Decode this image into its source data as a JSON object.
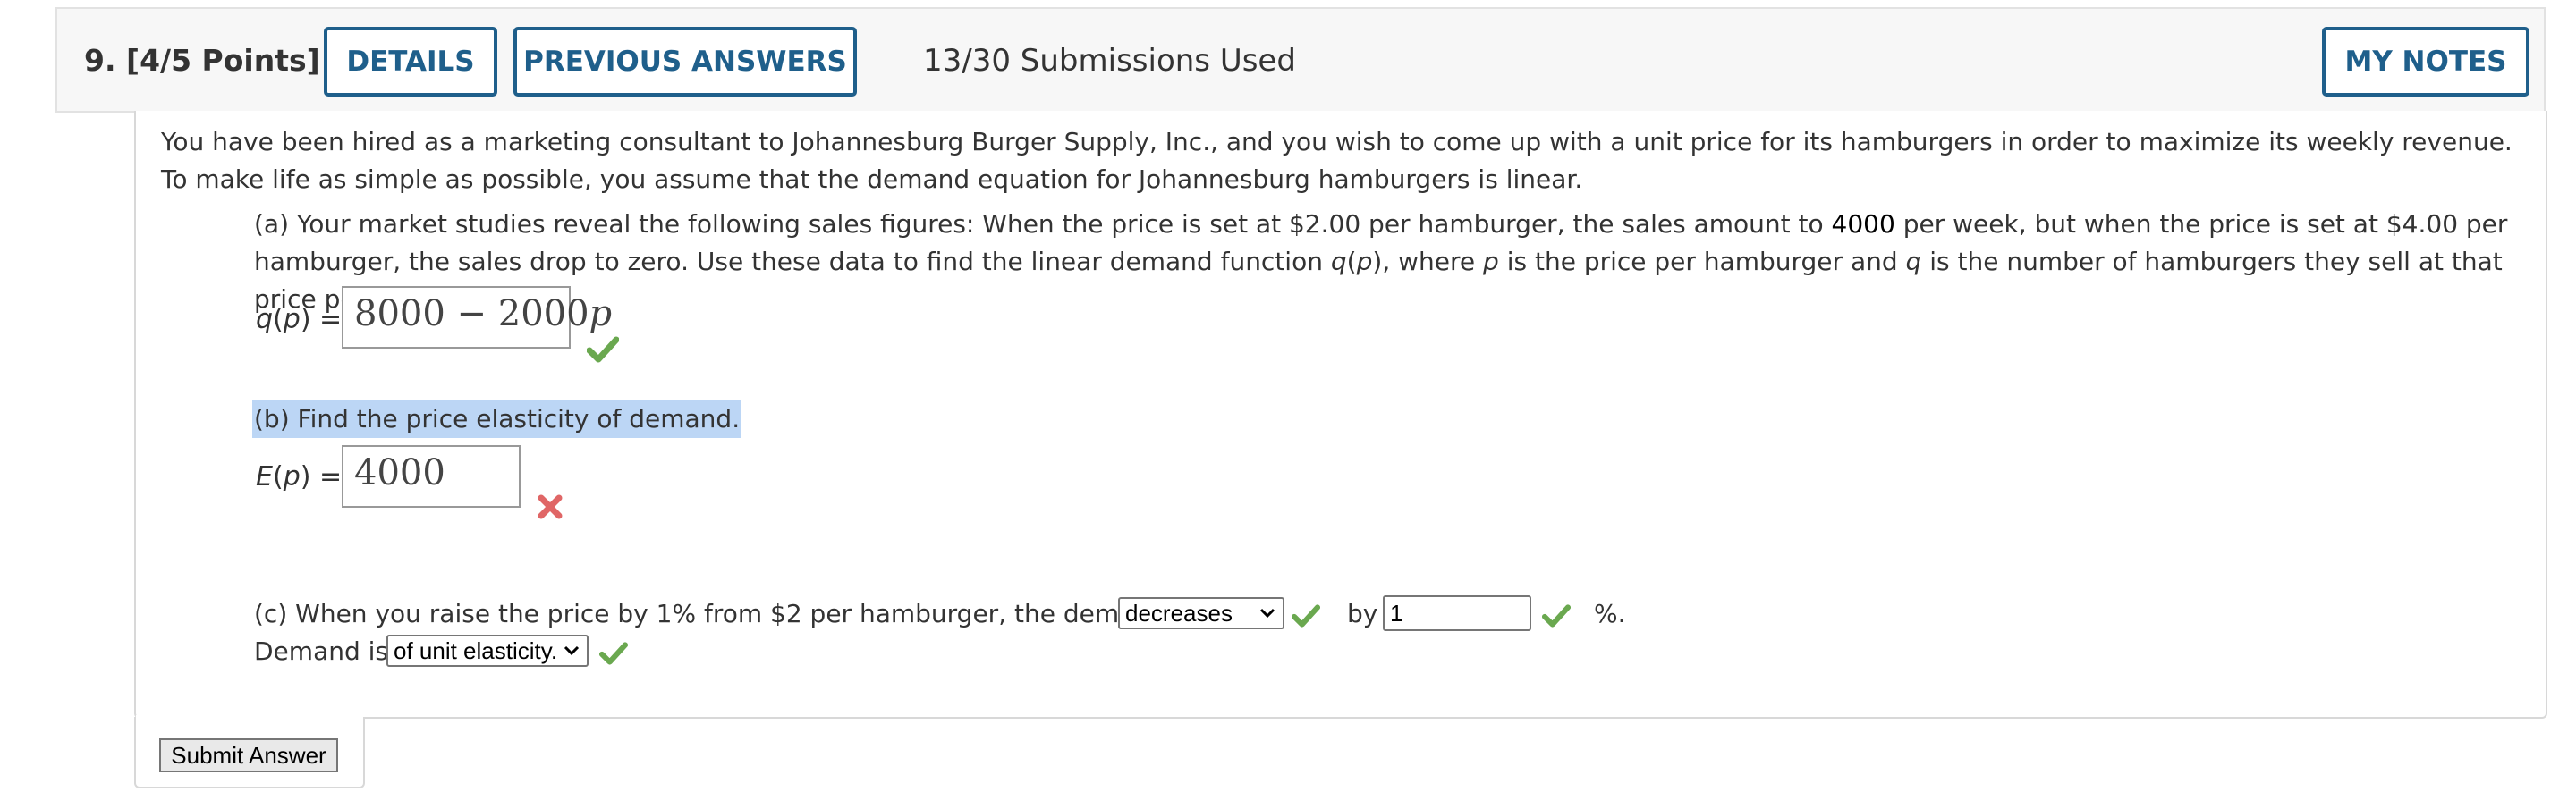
{
  "header": {
    "question_number": "9.",
    "points": "[4/5 Points]",
    "details_label": "DETAILS",
    "previous_answers_label": "PREVIOUS ANSWERS",
    "submissions": "13/30 Submissions Used",
    "my_notes_label": "MY NOTES"
  },
  "question": {
    "intro": "You have been hired as a marketing consultant to Johannesburg Burger Supply, Inc., and you wish to come up with a unit price for its hamburgers in order to maximize its weekly revenue. To make life as simple as possible, you assume that the demand equation for Johannesburg hamburgers is linear.",
    "part_a": {
      "text_1": "(a) Your market studies reveal the following sales figures: When the price is set at $2.00 per hamburger, the sales amount to ",
      "sales_amount": "4000",
      "text_2": " per week, but when the price is set at $4.00 per hamburger, the sales drop to zero. Use these data to find the linear demand function ",
      "func_q": "q",
      "func_open": "(",
      "func_p": "p",
      "func_close": ")",
      "text_3": ", where ",
      "var_p": "p",
      "text_4": " is the price per hamburger and ",
      "var_q": "q",
      "text_5": " is the number of hamburgers they sell at that price per week.",
      "label_func": "q",
      "label_arg": "p",
      "answer_main": "8000 − 2000",
      "answer_var": "p",
      "status": "correct"
    },
    "part_b": {
      "text": "(b) Find the price elasticity of demand.",
      "label_func": "E",
      "label_arg": "p",
      "answer": "4000",
      "status": "incorrect"
    },
    "part_c": {
      "text_1": "(c) When you raise the price by 1% from $2 per hamburger, the demand",
      "demand_selected": "decreases",
      "by_label": "by",
      "percent_value": "1",
      "percent_sign": "%.",
      "text_2": "Demand is",
      "elasticity_selected": "of unit elasticity."
    },
    "submit_label": "Submit Answer"
  },
  "colors": {
    "button_blue": "#1f5f8b",
    "check_green": "#6aa84f",
    "x_red": "#e06666",
    "highlight": "#bcd6f5"
  },
  "icons": {
    "correct": "check-icon",
    "incorrect": "x-icon",
    "dropdown": "chevron-down-icon"
  }
}
